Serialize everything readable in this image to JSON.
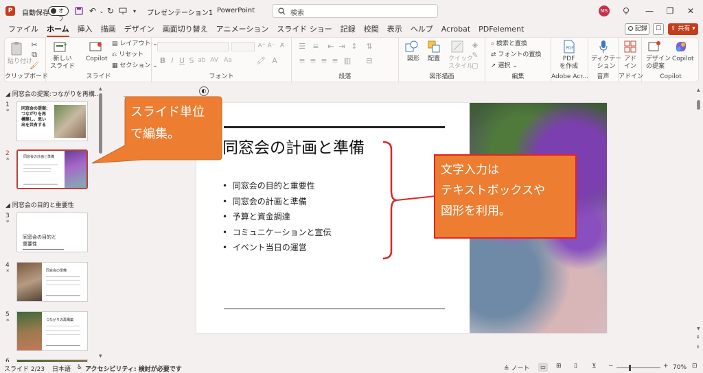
{
  "titlebar": {
    "autosave_label": "自動保存",
    "autosave_state": "オフ",
    "doc_title": "プレゼンテーション1",
    "separator": "-",
    "app_name": "PowerPoint",
    "search_placeholder": "検索",
    "avatar_initials": "MS"
  },
  "tabs": [
    "ファイル",
    "ホーム",
    "挿入",
    "描画",
    "デザイン",
    "画面切り替え",
    "アニメーション",
    "スライド ショー",
    "記録",
    "校閲",
    "表示",
    "ヘルプ",
    "Acrobat",
    "PDFelement"
  ],
  "tab_actions": {
    "record": "記録",
    "share": "共有"
  },
  "ribbon": {
    "groups": {
      "clipboard": "クリップボード",
      "slides": "スライド",
      "font": "フォント",
      "paragraph": "段落",
      "drawing": "図形描画",
      "editing": "編集",
      "adobe": "Adobe Acr...",
      "voice": "音声",
      "addins": "アドイン",
      "copilot": "Copilot"
    },
    "paste": "貼り付け",
    "new_slide": "新しい\nスライド",
    "copilot": "Copilot",
    "layout": "レイアウト",
    "reset": "リセット",
    "section": "セクション",
    "shapes": "図形",
    "arrange": "配置",
    "quick_styles": "クイック\nスタイル",
    "find": "検索と置換",
    "replace_font": "フォントの置換",
    "select": "選択",
    "pdf": "PDF\nを作成",
    "dictate": "ディクテー\nション",
    "addin": "アド\nイン",
    "design_ideas": "デザイン\nの提案",
    "copilot2": "Copilot"
  },
  "thumbs": {
    "section1": "同窓会の提案:つながりを再構…",
    "section2": "同窓会の目的と重要性",
    "t1_title": "同窓会の提案:\nつながりを再\n構築し、思い\n出を共有する",
    "t2_title": "同窓会の計画と準備",
    "t3_title": "同窓会の目的と\n重要性",
    "t4_title": "同窓会の準備",
    "t5_title": "つながりの再構築",
    "numbers": [
      "1",
      "2",
      "3",
      "4",
      "5",
      "6"
    ],
    "star": "*"
  },
  "slide": {
    "title": "同窓会の計画と準備",
    "bullets": [
      "同窓会の目的と重要性",
      "同窓会の計画と準備",
      "予算と資金調達",
      "コミュニケーションと宣伝",
      "イベント当日の運営"
    ]
  },
  "callouts": {
    "left": "スライド単位\nで編集。",
    "right": "文字入力は\nテキストボックスや\n図形を利用。"
  },
  "status": {
    "slide_pos": "スライド 2/23",
    "language": "日本語",
    "accessibility": "アクセシビリティ: 検討が必要です",
    "notes": "ノート",
    "zoom": "70%"
  },
  "colors": {
    "accent": "#c43e1c",
    "callout": "#ed7d31",
    "bracket": "#e02424"
  }
}
